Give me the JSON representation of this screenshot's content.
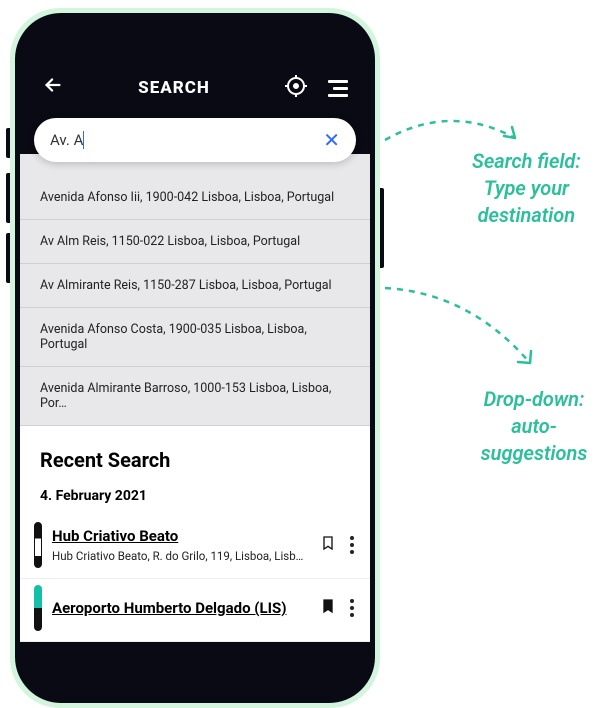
{
  "header": {
    "title": "SEARCH"
  },
  "search": {
    "value": "Av. A"
  },
  "suggestions": [
    "Avenida Afonso Iii, 1900-042 Lisboa, Lisboa, Portugal",
    "Av Alm Reis, 1150-022 Lisboa, Lisboa, Portugal",
    "Av Almirante Reis, 1150-287 Lisboa, Lisboa, Portugal",
    "Avenida Afonso Costa, 1900-035 Lisboa, Lisboa, Portugal",
    "Avenida Almirante Barroso, 1000-153 Lisboa, Lisboa, Por…"
  ],
  "recent": {
    "heading": "Recent Search",
    "date": "4. February 2021",
    "items": [
      {
        "name": "Hub Criativo Beato",
        "sub": "Hub Criativo Beato, R. do Grilo, 119, Lisboa, Lisb…"
      },
      {
        "name": "Aeroporto Humberto Delgado (LIS)",
        "sub": ""
      }
    ]
  },
  "annotations": {
    "search_field_l1": "Search field:",
    "search_field_l2": "Type your",
    "search_field_l3": "destination",
    "dropdown_l1": "Drop-down:",
    "dropdown_l2": "auto-suggestions"
  }
}
